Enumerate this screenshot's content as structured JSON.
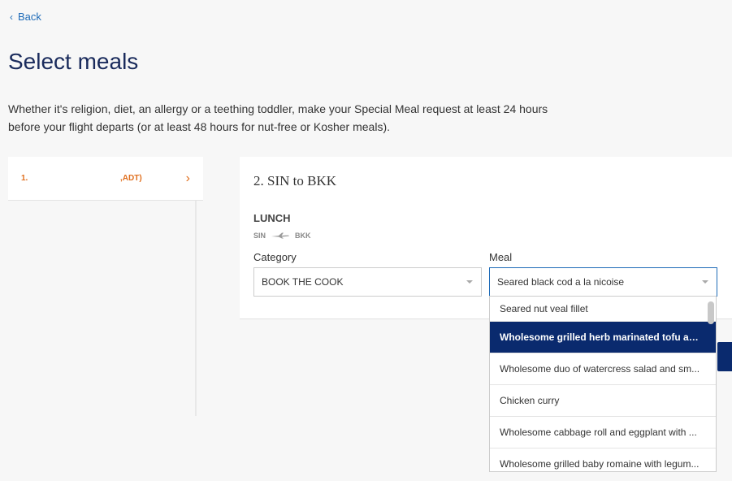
{
  "nav": {
    "back_label": "Back"
  },
  "page": {
    "title": "Select meals",
    "intro": "Whether it's religion, diet, an allergy or a teething toddler, make your Special Meal request at least 24 hours before your flight departs (or at least 48 hours for nut-free or Kosher meals)."
  },
  "passenger": {
    "number": "1.",
    "type": ",ADT)"
  },
  "flight": {
    "sector": "2. SIN to BKK",
    "meal_type": "LUNCH",
    "origin": "SIN",
    "destination": "BKK"
  },
  "form": {
    "category_label": "Category",
    "category_value": "BOOK THE COOK",
    "meal_label": "Meal",
    "meal_value": "Seared black cod a la nicoise"
  },
  "dropdown": {
    "options": [
      "Seared nut veal fillet",
      "Wholesome grilled herb marinated tofu and ...",
      "Wholesome duo of watercress salad and sm...",
      "Chicken curry",
      "Wholesome cabbage roll and eggplant with ...",
      "Wholesome grilled baby romaine with legum..."
    ],
    "active_index": 1
  },
  "colors": {
    "accent": "#0a2a6e",
    "link": "#1e6bb8",
    "orange": "#e06f1e"
  }
}
